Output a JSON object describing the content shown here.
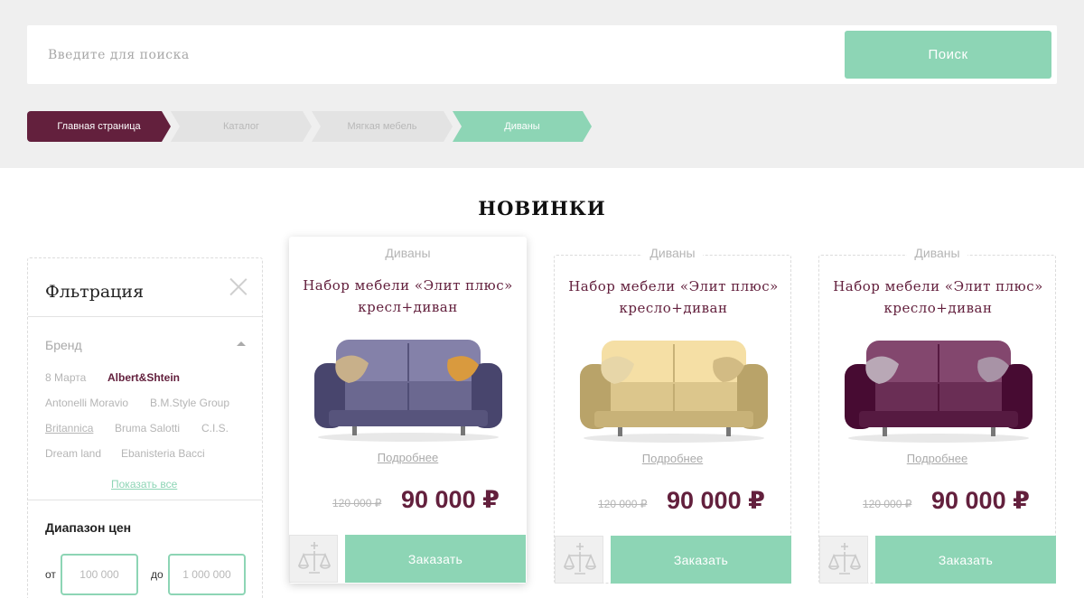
{
  "search": {
    "placeholder": "Введите для поиска",
    "button": "Поиск"
  },
  "breadcrumb": [
    {
      "label": "Главная страница"
    },
    {
      "label": "Каталог"
    },
    {
      "label": "Мягкая мебель"
    },
    {
      "label": "Диваны"
    }
  ],
  "section_title": "НОВИНКИ",
  "filter": {
    "title": "Фльтрация",
    "brand_heading": "Бренд",
    "brands": [
      "8 Марта",
      "Albert&Shtein",
      "Antonelli Moravio",
      "B.M.Style Group",
      "Britannica",
      "Bruma Salotti",
      "C.I.S.",
      "Dream land",
      "Ebanisteria Bacci"
    ],
    "active_brand": "Albert&Shtein",
    "show_all": "Показать все",
    "price_heading": "Диапазон цен",
    "from_label": "от",
    "to_label": "до",
    "from_placeholder": "100 000",
    "to_placeholder": "1 000 000"
  },
  "products": [
    {
      "category": "Диваны",
      "name": "Набор мебели «Элит плюс» кресл+диван",
      "more": "Подробнее",
      "old_price": "120 000 ₽",
      "price": "90 000 ₽",
      "order": "Заказать",
      "sofa_color": "#6b6890",
      "pillow_a": "#c8b08a",
      "pillow_b": "#d99a3e"
    },
    {
      "category": "Диваны",
      "name": "Набор мебели «Элит плюс» кресло+диван",
      "more": "Подробнее",
      "old_price": "120 000 ₽",
      "price": "90 000 ₽",
      "order": "Заказать",
      "sofa_color": "#dcc68c",
      "pillow_a": "#e7d6a8",
      "pillow_b": "#d2bb84"
    },
    {
      "category": "Диваны",
      "name": "Набор мебели «Элит плюс» кресло+диван",
      "more": "Подробнее",
      "old_price": "120 000 ₽",
      "price": "90 000 ₽",
      "order": "Заказать",
      "sofa_color": "#6a2e55",
      "pillow_a": "#b9a8b6",
      "pillow_b": "#a893a6"
    }
  ],
  "colors": {
    "accent": "#8dd5b5",
    "brand": "#63203d"
  }
}
